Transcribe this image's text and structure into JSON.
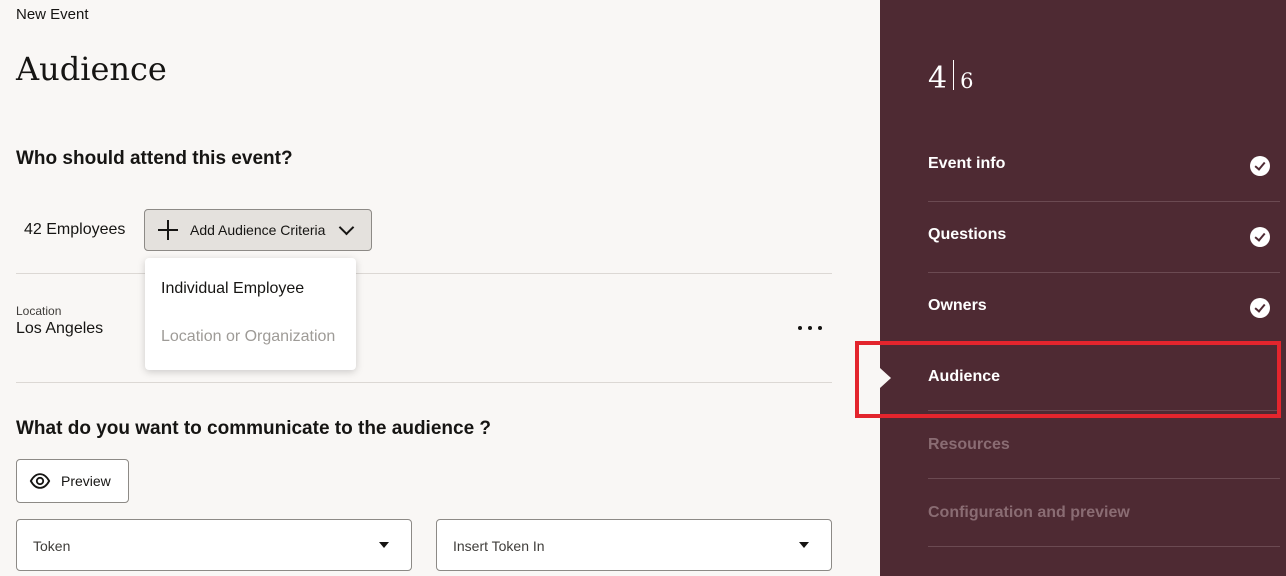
{
  "header": {
    "breadcrumb": "New Event",
    "title": "Audience"
  },
  "audience": {
    "question": "Who should attend this event?",
    "employee_count": "42 Employees",
    "add_criteria_label": "Add Audience Criteria",
    "menu": {
      "items": [
        {
          "label": "Individual Employee",
          "enabled": true
        },
        {
          "label": "Location or Organization",
          "enabled": false
        }
      ]
    },
    "criteria_row": {
      "label": "Location",
      "value": "Los Angeles"
    }
  },
  "communicate": {
    "question": "What do you want to communicate to the audience ?",
    "preview_label": "Preview",
    "token_select": {
      "label": "Token"
    },
    "insert_select": {
      "label": "Insert Token In"
    }
  },
  "sidebar": {
    "step_current": "4",
    "step_total": "6",
    "items": [
      {
        "label": "Event info",
        "status": "complete"
      },
      {
        "label": "Questions",
        "status": "complete"
      },
      {
        "label": "Owners",
        "status": "complete"
      },
      {
        "label": "Audience",
        "status": "current"
      },
      {
        "label": "Resources",
        "status": "disabled"
      },
      {
        "label": "Configuration and preview",
        "status": "disabled"
      }
    ]
  },
  "colors": {
    "sidebar_bg": "#4e2a33",
    "page_bg": "#f9f7f5",
    "highlight": "#e3252d"
  }
}
